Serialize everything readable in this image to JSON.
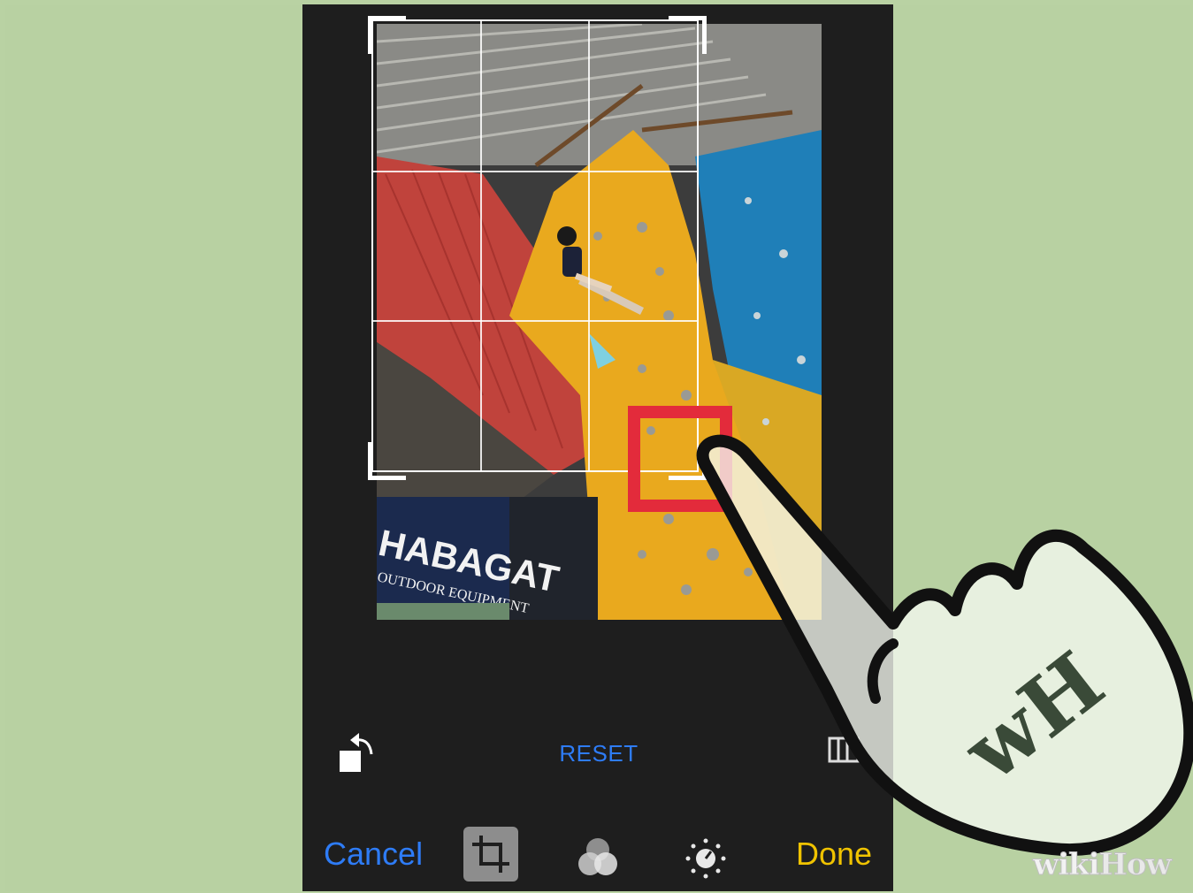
{
  "toolbar": {
    "cancel_label": "Cancel",
    "done_label": "Done",
    "reset_label": "RESET"
  },
  "icons": {
    "rotate": "rotate-icon",
    "aspect": "aspect-ratio-icon",
    "crop": "crop-icon",
    "filters": "filters-icon",
    "adjust": "adjust-light-icon"
  },
  "photo": {
    "sign_text_1": "HABAGAT",
    "sign_text_2": "OUTDOOR EQUIPMENT"
  },
  "watermark": {
    "wiki": "wiki",
    "how": "How",
    "logo_letters": "wH"
  },
  "colors": {
    "accent_blue": "#2e7cf6",
    "done_yellow": "#f0c300",
    "highlight_red": "#e32b3b",
    "backdrop_green": "#b8d1a2"
  }
}
